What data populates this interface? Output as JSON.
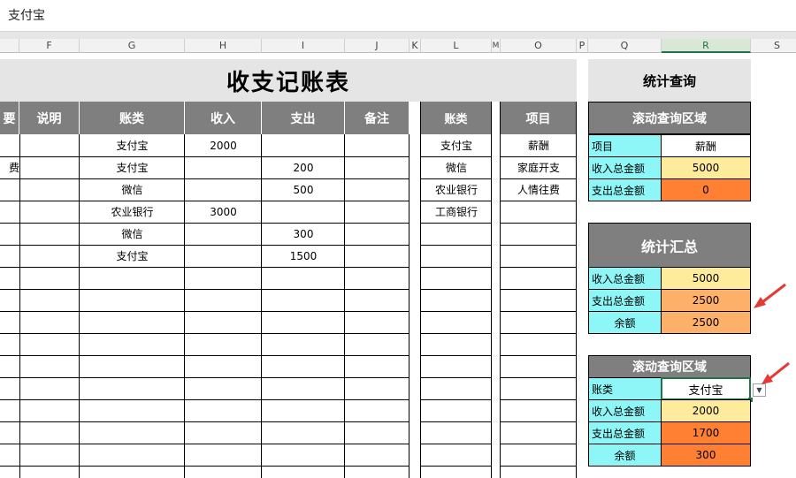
{
  "formula_bar": {
    "value": "支付宝"
  },
  "columns": [
    "F",
    "G",
    "H",
    "I",
    "J",
    "K",
    "L",
    "M",
    "O",
    "P",
    "Q",
    "R",
    "S"
  ],
  "selected_column": "R",
  "ledger": {
    "title": "收支记账表",
    "headers": {
      "partial": "要",
      "desc": "说明",
      "account": "账类",
      "income": "收入",
      "expense": "支出",
      "note": "备注"
    },
    "rows": [
      {
        "partial": "",
        "account": "支付宝",
        "income": "2000",
        "expense": ""
      },
      {
        "partial": "费",
        "account": "支付宝",
        "income": "",
        "expense": "200"
      },
      {
        "partial": "",
        "account": "微信",
        "income": "",
        "expense": "500"
      },
      {
        "partial": "",
        "account": "农业银行",
        "income": "3000",
        "expense": ""
      },
      {
        "partial": "",
        "account": "微信",
        "income": "",
        "expense": "300"
      },
      {
        "partial": "",
        "account": "支付宝",
        "income": "",
        "expense": "1500"
      }
    ]
  },
  "lists": {
    "accounts_header": "账类",
    "accounts": [
      "支付宝",
      "微信",
      "农业银行",
      "工商银行"
    ],
    "items_header": "项目",
    "items": [
      "薪酬",
      "家庭开支",
      "人情往费"
    ]
  },
  "stats": {
    "title": "统计查询",
    "scroll1": {
      "header": "滚动查询区域",
      "item_label": "项目",
      "item_value": "薪酬",
      "income_label": "收入总金额",
      "income_value": "5000",
      "expense_label": "支出总金额",
      "expense_value": "0"
    },
    "summary": {
      "header": "统计汇总",
      "income_label": "收入总金额",
      "income_value": "5000",
      "expense_label": "支出总金额",
      "expense_value": "2500",
      "balance_label": "余额",
      "balance_value": "2500"
    },
    "scroll2": {
      "header": "滚动查询区域",
      "account_label": "账类",
      "account_value": "支付宝",
      "income_label": "收入总金额",
      "income_value": "2000",
      "expense_label": "支出总金额",
      "expense_value": "1700",
      "balance_label": "余额",
      "balance_value": "300"
    }
  },
  "colors": {
    "cyan": "#8ef6f6",
    "yellow": "#ffeb9c",
    "orange": "#ff7f33",
    "header_gray": "#7f7f7f",
    "arrow_red": "#e53935"
  }
}
